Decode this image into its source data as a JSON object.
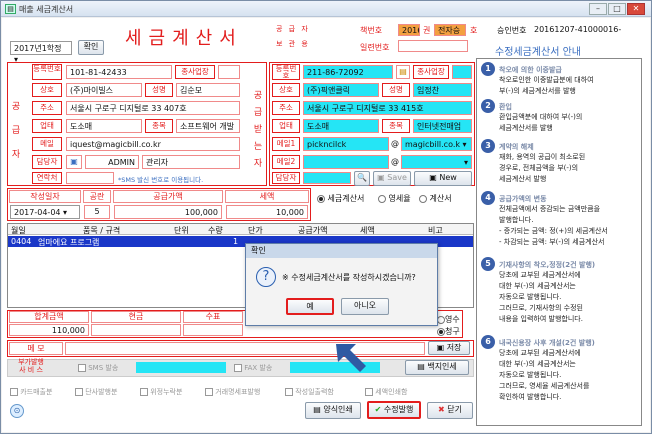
{
  "window": {
    "title": "매출 세금계산서"
  },
  "header": {
    "year": "2017년1학정",
    "confirm_btn": "확인",
    "main_title": "세금계산서",
    "sub1": "공 급 자",
    "sub2": "보 관 용",
    "book_label": "책번호",
    "book_val1": "2016",
    "book_val2": "권",
    "book_val3": "전자승",
    "book_val4": "호",
    "approval_label": "승인번호",
    "approval_no": "20161207-41000016-",
    "serial_label": "일련번호",
    "info_title": "수정세금계산서 안내"
  },
  "supplier": {
    "side": "공급자",
    "reg_label": "등록번호",
    "reg": "101-81-42433",
    "branch_label": "종사업장",
    "company_label": "상호",
    "company": "(주)마이빌스",
    "name_label": "성명",
    "name": "김순모",
    "addr_label": "주소",
    "addr": "서울시 구로구 디지털로 33 407호",
    "biz_label": "업태",
    "biz": "도소매",
    "item_label": "종목",
    "item": "소프트웨어 개발",
    "email_label": "메일",
    "email": "iquest@magicbill.co.kr",
    "person_label": "담당자",
    "person_id": "ADMIN",
    "person_name": "관리자",
    "contact_label": "연락처",
    "sms_note": "*SMS 발신 번호로 이용됩니다."
  },
  "buyer": {
    "side": "공급받는자",
    "reg_label": "등록번호",
    "reg": "211-86-72092",
    "branch_label": "종사업장",
    "company_label": "상호",
    "company": "(주)픽앤클릭",
    "name_label": "성명",
    "name": "임정찬",
    "addr_label": "주소",
    "addr": "서울시 구로구 디지털로 33 415호",
    "biz_label": "업태",
    "biz": "도소매",
    "item_label": "종목",
    "item": "인터넷전매업",
    "email1_label": "메일1",
    "email1_id": "pickncilck",
    "email1_domain": "magicbill.co.k",
    "email2_label": "메일2",
    "person_label": "담당자",
    "save_btn": "Save",
    "new_btn": "New"
  },
  "totals": {
    "date_label": "작성일자",
    "blank_label": "공란",
    "supply_label": "공급가액",
    "tax_label": "세액",
    "date": "2017-04-04",
    "blank": "5",
    "supply": "100,000",
    "tax": "10,000",
    "kind": [
      "세금계산서",
      "영세율",
      "계산서"
    ]
  },
  "items": {
    "headers": [
      "월일",
      "품목 / 규격",
      "단위",
      "수량",
      "단가",
      "공급가액",
      "세액",
      "비고"
    ],
    "rows": [
      {
        "date": "0404",
        "name": "엄마에요 프로그램",
        "unit": "",
        "qty": "",
        "price": "1",
        "supply": "",
        "tax": "",
        "note": ""
      }
    ]
  },
  "payment": {
    "total_label": "합계금액",
    "cash_label": "현금",
    "check_label": "수표",
    "total": "110,000",
    "receipt": "영수",
    "claim": "청구"
  },
  "memo": {
    "label": "메 모",
    "save_btn": "저장"
  },
  "extra": {
    "label1": "부가발행",
    "label2": "사 비 스",
    "sms": "SMS 발송",
    "fax": "FAX 발송",
    "print_btn": "백지인세"
  },
  "bottom": {
    "checks": [
      "카드매출분",
      "단사발행분",
      "위정누락분",
      "거래명세표발행",
      "작성일출력함",
      "세액인쇄함"
    ],
    "print_btn": "양식인쇄",
    "modify_btn": "수정발행",
    "close_btn": "닫기"
  },
  "dialog": {
    "title": "확인",
    "message": "※ 수정세금계산서를 작성하시겠습니까?",
    "yes": "예",
    "no": "아니오"
  },
  "guide": [
    {
      "n": "1",
      "h": "착오에 의한 이중발급",
      "b": [
        "착오로인한 이중발급분에 대하여",
        "부(-)의 세금계산서를 발행"
      ]
    },
    {
      "n": "2",
      "h": "환입",
      "b": [
        "환입금액분에 대하여 부(-)의",
        "세금계산서를 발행"
      ]
    },
    {
      "n": "3",
      "h": "계약의 해제",
      "b": [
        "재화, 용역의 공급이 최소로된",
        "경우로, 전체금액을 부(-)의",
        "세금계산서 발행"
      ]
    },
    {
      "n": "4",
      "h": "공급가액의 변동",
      "b": [
        "전체금액에서 증감되는 금액만큼을",
        "발행합니다.",
        "- 증가되는 금액: 정(+)의 세금계산서",
        "- 차감되는 금액: 부(-)의 세금계산서"
      ]
    },
    {
      "n": "5",
      "h": "기재사항의 착오,정정(2건 발행)",
      "b": [
        "당초에 교부된 세금계산서에",
        "대한 부(-)의 세금계산서는",
        "자동으로 발행됩니다.",
        "그러므로, 기재사항의 수정된",
        "내용을 입력하여 발행합니다."
      ]
    },
    {
      "n": "6",
      "h": "내국신용장 사후 개설(2건 발행)",
      "b": [
        "당초에 교부된 세금계산서에",
        "대한 부(-)의 세금계산서는",
        "자동으로 발행됩니다.",
        "그러므로, 영세율 세금계산서를",
        "확인하여 발행합니다."
      ]
    }
  ],
  "colors": {
    "accent_red": "#e31d1d",
    "cyan": "#25e5f5",
    "step_blue": "#3a5fa8",
    "selected_row": "#1a37c8"
  }
}
